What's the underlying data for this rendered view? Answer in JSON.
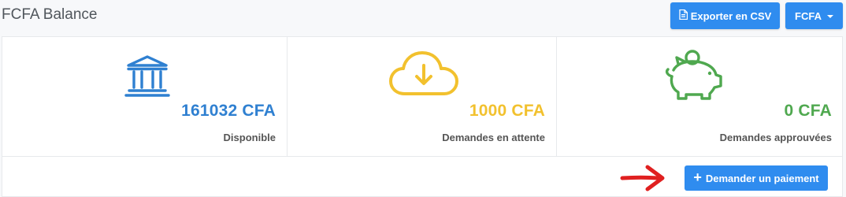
{
  "header": {
    "title": "FCFA Balance",
    "export_label": "Exporter en CSV",
    "export_icon": "file-icon",
    "currency_label": "FCFA"
  },
  "cards": [
    {
      "icon": "bank-icon",
      "value": "161032 CFA",
      "label": "Disponible",
      "color": "#2f80d1"
    },
    {
      "icon": "cloud-download-icon",
      "value": "1000 CFA",
      "label": "Demandes en attente",
      "color": "#f2c12e"
    },
    {
      "icon": "piggy-bank-icon",
      "value": "0 CFA",
      "label": "Demandes approuvées",
      "color": "#4fa84f"
    }
  ],
  "footer": {
    "request_label": "Demander un paiement"
  },
  "colors": {
    "primary": "#2f8cef",
    "annotation_arrow": "#e02020"
  }
}
